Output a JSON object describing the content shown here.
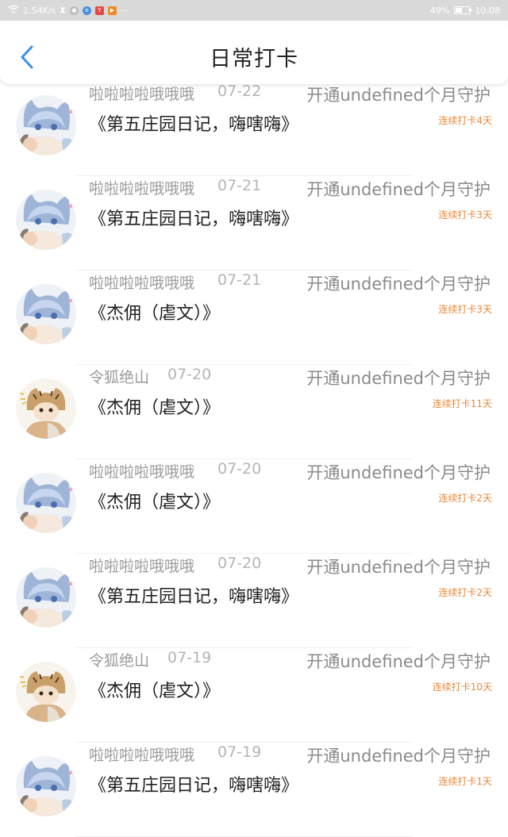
{
  "status_bar": {
    "speed": "1.54K/s",
    "battery": "49%",
    "battery_level": 0.49,
    "time": "10:08",
    "more": "···"
  },
  "header": {
    "title": "日常打卡"
  },
  "entries": [
    {
      "name": "啦啦啦啦哦哦哦",
      "date": "07-22",
      "diary": "《第五庄园日记，嗨嗐嗨》",
      "guard": "开通undefined个月守护",
      "streak": "连续打卡4天",
      "avatar": "cat-avatar"
    },
    {
      "name": "啦啦啦啦哦哦哦",
      "date": "07-21",
      "diary": "《第五庄园日记，嗨嗐嗨》",
      "guard": "开通undefined个月守护",
      "streak": "连续打卡3天",
      "avatar": "cat-avatar"
    },
    {
      "name": "啦啦啦啦哦哦哦",
      "date": "07-21",
      "diary": "《杰佣（虐文）》",
      "guard": "开通undefined个月守护",
      "streak": "连续打卡3天",
      "avatar": "cat-avatar"
    },
    {
      "name": "令狐绝山",
      "date": "07-20",
      "diary": "《杰佣（虐文）》",
      "guard": "开通undefined个月守护",
      "streak": "连续打卡11天",
      "avatar": "tiger-avatar"
    },
    {
      "name": "啦啦啦啦哦哦哦",
      "date": "07-20",
      "diary": "《杰佣（虐文）》",
      "guard": "开通undefined个月守护",
      "streak": "连续打卡2天",
      "avatar": "cat-avatar"
    },
    {
      "name": "啦啦啦啦哦哦哦",
      "date": "07-20",
      "diary": "《第五庄园日记，嗨嗐嗨》",
      "guard": "开通undefined个月守护",
      "streak": "连续打卡2天",
      "avatar": "cat-avatar"
    },
    {
      "name": "令狐绝山",
      "date": "07-19",
      "diary": "《杰佣（虐文）》",
      "guard": "开通undefined个月守护",
      "streak": "连续打卡10天",
      "avatar": "tiger-avatar"
    },
    {
      "name": "啦啦啦啦哦哦哦",
      "date": "07-19",
      "diary": "《第五庄园日记，嗨嗐嗨》",
      "guard": "开通undefined个月守护",
      "streak": "连续打卡1天",
      "avatar": "cat-avatar"
    }
  ],
  "colors": {
    "accent": "#1e90ff",
    "streak": "#e8883a",
    "status_bar": "#d9d9d9"
  }
}
